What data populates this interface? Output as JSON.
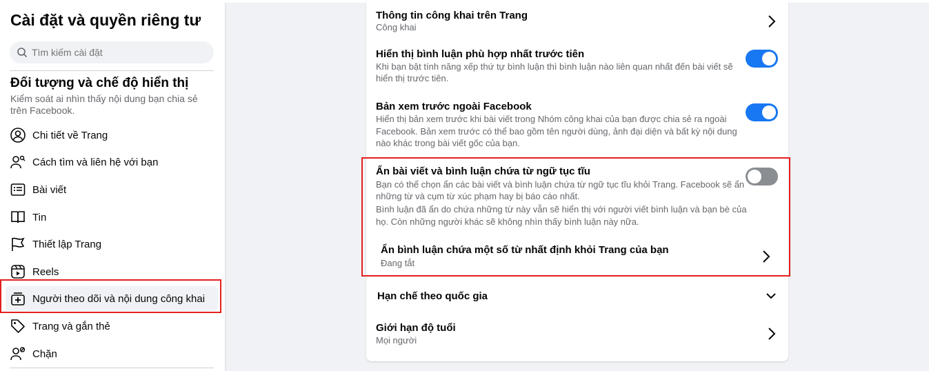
{
  "sidebar": {
    "title": "Cài đặt và quyền riêng tư",
    "search_placeholder": "Tìm kiếm cài đặt",
    "section_title": "Đối tượng và chế độ hiển thị",
    "section_desc": "Kiểm soát ai nhìn thấy nội dung bạn chia sẻ trên Facebook.",
    "items": [
      {
        "label": "Chi tiết về Trang",
        "icon": "user-circle-icon"
      },
      {
        "label": "Cách tìm và liên hệ với bạn",
        "icon": "user-search-icon"
      },
      {
        "label": "Bài viết",
        "icon": "post-icon"
      },
      {
        "label": "Tin",
        "icon": "book-icon"
      },
      {
        "label": "Thiết lập Trang",
        "icon": "flag-icon"
      },
      {
        "label": "Reels",
        "icon": "reels-icon"
      },
      {
        "label": "Người theo dõi và nội dung công khai",
        "icon": "follow-add-icon"
      },
      {
        "label": "Trang và gắn thẻ",
        "icon": "tag-icon"
      },
      {
        "label": "Chặn",
        "icon": "user-block-icon"
      }
    ]
  },
  "main": {
    "public_info": {
      "title": "Thông tin công khai trên Trang",
      "sub": "Công khai"
    },
    "relevant_comments": {
      "title": "Hiển thị bình luận phù hợp nhất trước tiên",
      "desc1": "Khi bạn bật tính năng xếp thứ tự bình luận thì bình luận nào liên quan nhất đến bài viết sẽ",
      "desc2": "hiển thị trước tiên.",
      "on": true
    },
    "preview": {
      "title": "Bản xem trước ngoài Facebook",
      "desc1": "Hiển thị bản xem trước khi bài viết trong Nhóm công khai của bạn được chia sẻ ra ngoài",
      "desc2": "Facebook. Bản xem trước có thể bao gồm tên người dùng, ảnh đại diện và bất kỳ nội dung",
      "desc3": "nào khác trong bài viết gốc của bạn.",
      "on": true
    },
    "profanity": {
      "title": "Ẩn bài viết và bình luận chứa từ ngữ tục tĩu",
      "desc1": "Bạn có thể chọn ẩn các bài viết và bình luận chứa từ ngữ tục tĩu khỏi Trang. Facebook sẽ ẩn",
      "desc2": "những từ và cụm từ xúc phạm hay bị báo cáo nhất.",
      "desc3": "Bình luận đã ẩn do chứa những từ này vẫn sẽ hiển thị với người viết bình luận và bạn bè của",
      "desc4": "họ. Còn những người khác sẽ không nhìn thấy bình luận này nữa.",
      "on": false
    },
    "hide_words": {
      "title": "Ẩn bình luận chứa một số từ nhất định khỏi Trang của bạn",
      "sub": "Đang tắt"
    },
    "country": {
      "title": "Hạn chế theo quốc gia"
    },
    "age": {
      "title": "Giới hạn độ tuổi",
      "sub": "Mọi người"
    }
  },
  "colors": {
    "accent": "#1877f2",
    "highlight": "#e41e1e"
  }
}
